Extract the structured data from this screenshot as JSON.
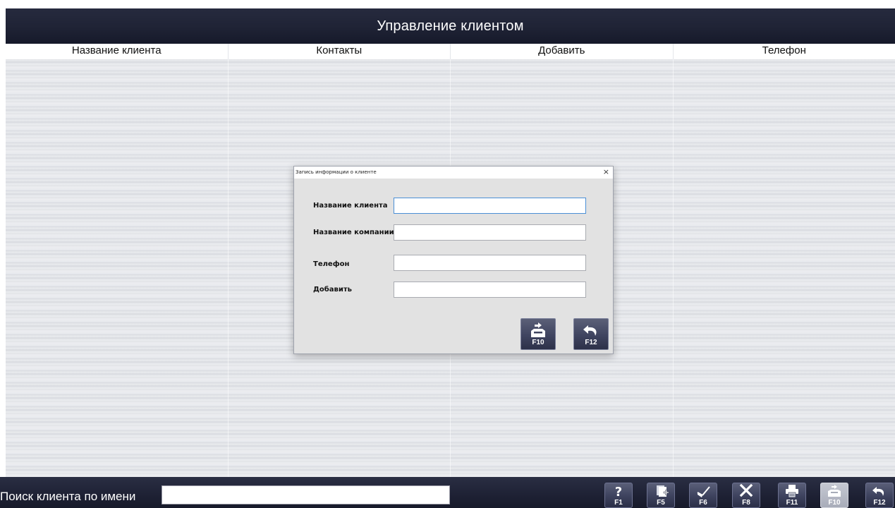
{
  "window": {
    "title": "Управление клиентом"
  },
  "table": {
    "columns": [
      "Название клиента",
      "Контакты",
      "Добавить",
      "Телефон"
    ]
  },
  "search": {
    "label": "Поиск клиента по имени",
    "value": ""
  },
  "toolbar": {
    "keys": [
      {
        "label": "F1",
        "icon": "help-icon"
      },
      {
        "label": "F5",
        "icon": "new-document-icon"
      },
      {
        "label": "F6",
        "icon": "edit-pencil-icon"
      },
      {
        "label": "F8",
        "icon": "delete-x-icon"
      },
      {
        "label": "F11",
        "icon": "printer-icon"
      },
      {
        "label": "F10",
        "icon": "save-tray-icon"
      },
      {
        "label": "F12",
        "icon": "undo-arrow-icon"
      }
    ]
  },
  "dialog": {
    "title": "Запись информации о клиенте",
    "close": "×",
    "fields": [
      {
        "label": "Название клиента",
        "value": ""
      },
      {
        "label": "Название компании",
        "value": ""
      },
      {
        "label": "Телефон",
        "value": ""
      },
      {
        "label": "Добавить",
        "value": ""
      }
    ],
    "buttons": {
      "save_label": "F10",
      "cancel_label": "F12"
    }
  },
  "colors": {
    "bar_dark": "#1f2335",
    "button_top": "#5a5f78",
    "button_bottom": "#2b2f47",
    "focus": "#4a8fd6"
  }
}
